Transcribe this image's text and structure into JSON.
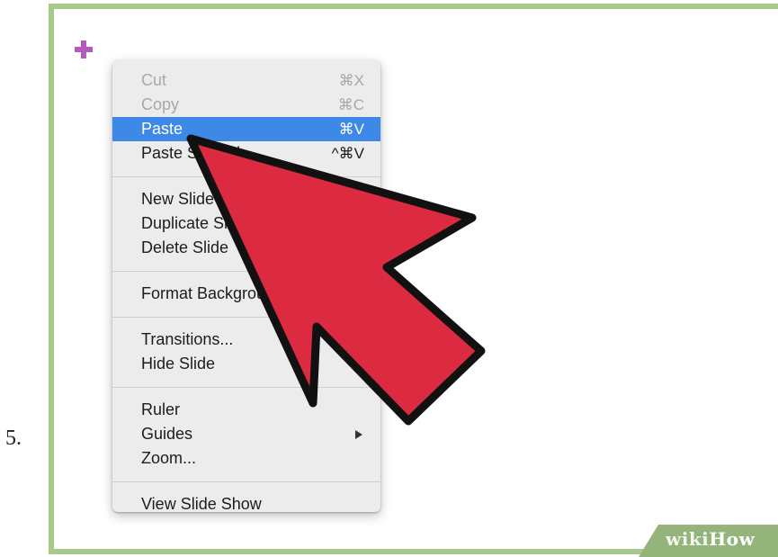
{
  "step": "5.",
  "colors": {
    "frame": "#a8c98c",
    "selection": "#3e88e8",
    "plus": "#b25bbd",
    "arrow": "#e0283e"
  },
  "context_menu": {
    "groups": [
      [
        {
          "label": "Cut",
          "shortcut": "⌘X",
          "disabled": true
        },
        {
          "label": "Copy",
          "shortcut": "⌘C",
          "disabled": true
        },
        {
          "label": "Paste",
          "shortcut": "⌘V",
          "selected": true
        },
        {
          "label": "Paste Special...",
          "shortcut": "^⌘V"
        }
      ],
      [
        {
          "label": "New Slide"
        },
        {
          "label": "Duplicate Slide"
        },
        {
          "label": "Delete Slide"
        }
      ],
      [
        {
          "label": "Format Background..."
        }
      ],
      [
        {
          "label": "Transitions..."
        },
        {
          "label": "Hide Slide"
        }
      ],
      [
        {
          "label": "Ruler"
        },
        {
          "label": "Guides",
          "submenu": true
        },
        {
          "label": "Zoom..."
        }
      ],
      [
        {
          "label": "View Slide Show"
        }
      ]
    ]
  },
  "watermark": {
    "wiki": "wiki",
    "how": "How"
  },
  "icons": {
    "plus": "plus-icon",
    "pointer": "arrow-pointer-icon",
    "submenu": "chevron-right-icon"
  }
}
